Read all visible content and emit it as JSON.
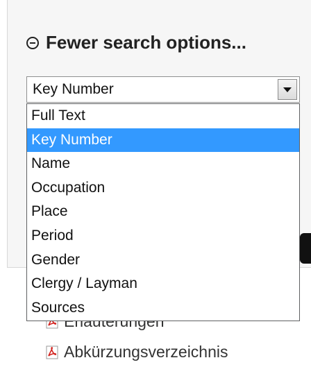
{
  "search": {
    "toggle_label": "Fewer search options...",
    "select_value": "Key Number",
    "options": [
      "Full Text",
      "Key Number",
      "Name",
      "Occupation",
      "Place",
      "Period",
      "Gender",
      "Clergy / Layman",
      "Sources"
    ],
    "selected_index": 1
  },
  "links": [
    {
      "label": "Erläuterungen",
      "icon": "pdf-icon"
    },
    {
      "label": "Abkürzungsverzeichnis",
      "icon": "pdf-icon"
    }
  ],
  "colors": {
    "highlight": "#3399ff",
    "panel": "#f6f6f6"
  }
}
